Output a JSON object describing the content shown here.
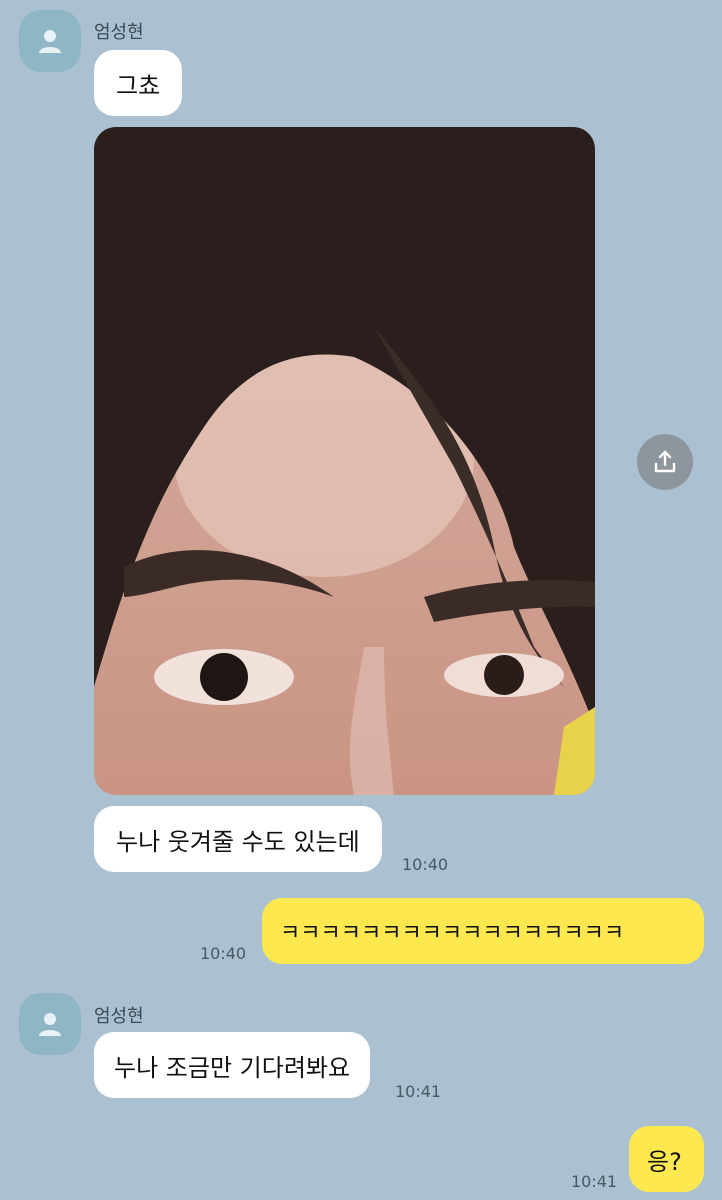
{
  "messages": [
    {
      "sender": "엄성현",
      "text": "그쵸"
    },
    {
      "photo": "selfie photo"
    },
    {
      "text": "누나 웃겨줄 수도 있는데",
      "time": "10:40"
    },
    {
      "mine": true,
      "text": "ㅋㅋㅋㅋㅋㅋㅋㅋㅋㅋㅋㅋㅋㅋㅋㅋㅋ",
      "time": "10:40"
    },
    {
      "sender": "엄성현",
      "text": "누나 조금만 기다려봐요",
      "time": "10:41"
    },
    {
      "mine": true,
      "text": "응?",
      "time": "10:41"
    }
  ],
  "icons": {
    "avatar": "person-icon",
    "share": "share-icon"
  },
  "colors": {
    "background": "#abc1d1",
    "incoming_bubble": "#ffffff",
    "outgoing_bubble": "#fde94f",
    "avatar": "#8fb6c5",
    "share_button": "#8e969d"
  }
}
